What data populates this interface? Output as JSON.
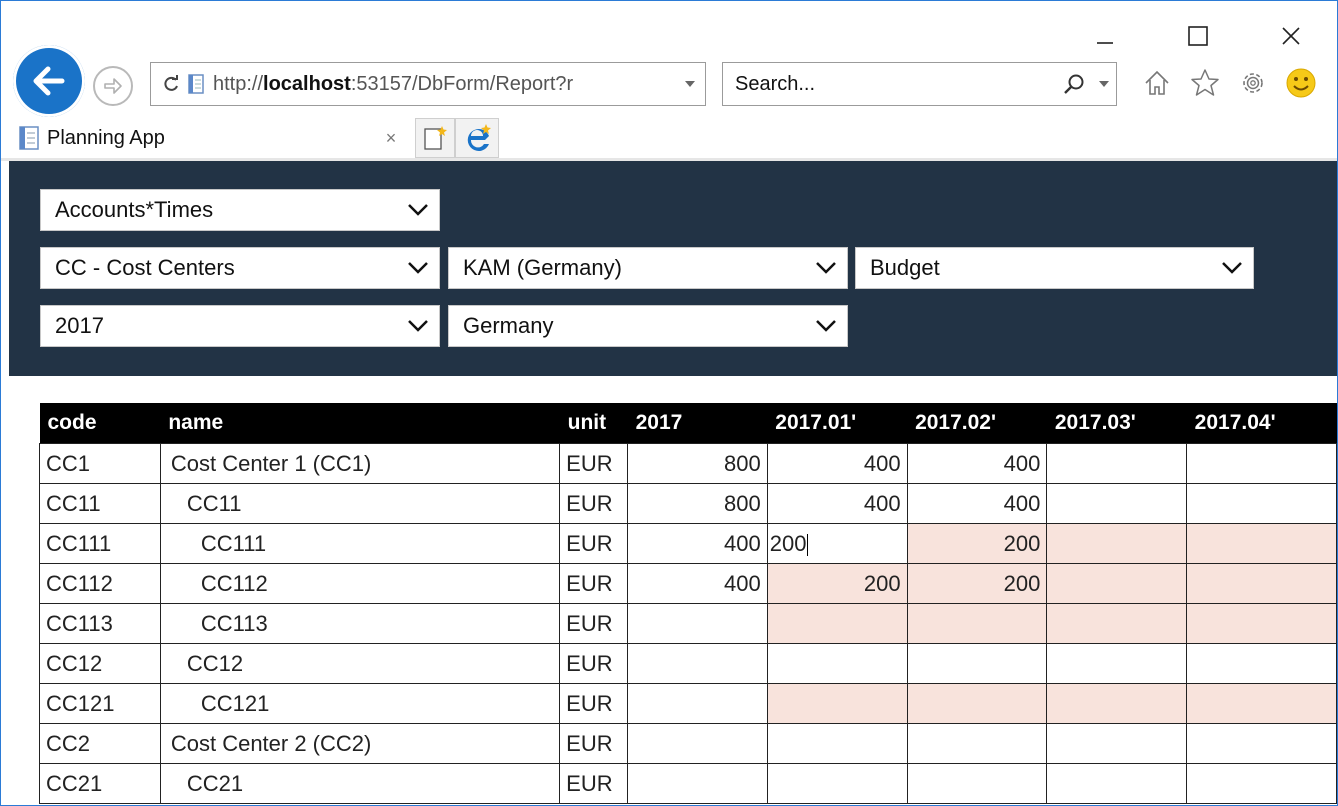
{
  "browser": {
    "url_host": "localhost",
    "url_prefix": "http://",
    "url_rest": ":53157/DbForm/Report?r",
    "search_placeholder": "Search...",
    "tab_title": "Planning App",
    "tab_close": "×"
  },
  "filters": {
    "row1": [
      "Accounts*Times"
    ],
    "row2": [
      "CC - Cost Centers",
      "KAM (Germany)",
      "Budget"
    ],
    "row3": [
      "2017",
      "Germany"
    ]
  },
  "grid": {
    "headers": [
      "code",
      "name",
      "unit",
      "2017",
      "2017.01'",
      "2017.02'",
      "2017.03'",
      "2017.04'"
    ],
    "rows": [
      {
        "code": "CC1",
        "name": "Cost Center 1 (CC1)",
        "indent": 0,
        "unit": "EUR",
        "v2017": "800",
        "m01": "400",
        "m02": "400"
      },
      {
        "code": "CC11",
        "name": "CC11",
        "indent": 1,
        "unit": "EUR",
        "v2017": "800",
        "m01": "400",
        "m02": "400"
      },
      {
        "code": "CC111",
        "name": "CC111",
        "indent": 2,
        "unit": "EUR",
        "v2017": "400",
        "m01": "200",
        "m02": "200",
        "editing": "m01",
        "pink": [
          "m02",
          "m03",
          "m04"
        ]
      },
      {
        "code": "CC112",
        "name": "CC112",
        "indent": 2,
        "unit": "EUR",
        "v2017": "400",
        "m01": "200",
        "m02": "200",
        "pink": [
          "m01",
          "m02",
          "m03",
          "m04"
        ]
      },
      {
        "code": "CC113",
        "name": "CC113",
        "indent": 2,
        "unit": "EUR",
        "v2017": "",
        "m01": "",
        "m02": "",
        "pink": [
          "m01",
          "m02",
          "m03",
          "m04"
        ]
      },
      {
        "code": "CC12",
        "name": "CC12",
        "indent": 1,
        "unit": "EUR",
        "v2017": "",
        "m01": "",
        "m02": ""
      },
      {
        "code": "CC121",
        "name": "CC121",
        "indent": 2,
        "unit": "EUR",
        "v2017": "",
        "m01": "",
        "m02": "",
        "pink": [
          "m01",
          "m02",
          "m03",
          "m04"
        ]
      },
      {
        "code": "CC2",
        "name": "Cost Center 2 (CC2)",
        "indent": 0,
        "unit": "EUR",
        "v2017": "",
        "m01": "",
        "m02": ""
      },
      {
        "code": "CC21",
        "name": "CC21",
        "indent": 1,
        "unit": "EUR",
        "v2017": "",
        "m01": "",
        "m02": ""
      }
    ]
  },
  "colors": {
    "panel": "#223345",
    "accent": "#1a73c8",
    "pink_cell": "#f8e3dc"
  },
  "icons": [
    "minimize-icon",
    "maximize-icon",
    "close-icon",
    "back-arrow-icon",
    "forward-arrow-icon",
    "refresh-icon",
    "page-icon",
    "dropdown-icon",
    "search-icon",
    "home-icon",
    "favorites-star-icon",
    "settings-gear-icon",
    "smiley-feedback-icon",
    "new-tab-icon",
    "ie-logo-icon",
    "chevron-down-icon"
  ]
}
